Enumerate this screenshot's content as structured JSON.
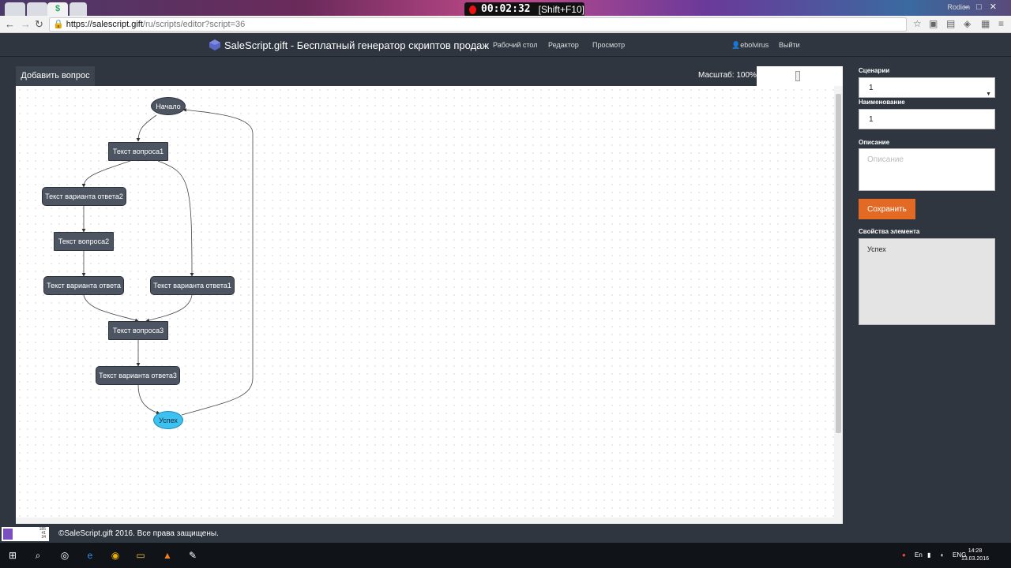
{
  "browser": {
    "url_host": "https://salescript.gift",
    "url_path": "/ru/scripts/editor?script=36",
    "tab_icon": "$"
  },
  "recording": {
    "time": "00:02:32",
    "hotkey": "[Shift+F10]"
  },
  "window": {
    "user": "Rodion"
  },
  "app": {
    "brand": "SaleScript.gift - Бесплатный генератор скриптов продаж",
    "nav": [
      "Рабочий стол",
      "Редактор",
      "Просмотр"
    ],
    "username": "ebolvirus",
    "logout": "Выйти"
  },
  "editor": {
    "add_question": "Добавить вопрос",
    "zoom_label": "Масштаб: 100%",
    "nodes": {
      "start": "Начало",
      "q1": "Текст вопроса1",
      "a2": "Текст варианта ответа2",
      "q2": "Текст вопроса2",
      "a0": "Текст варианта ответа",
      "a1": "Текст варианта ответа1",
      "q3": "Текст вопроса3",
      "a3": "Текст варианта ответа3",
      "success": "Успех"
    }
  },
  "panel": {
    "scenarios_label": "Сценарии",
    "scenario_value": "1",
    "name_label": "Наименование",
    "name_value": "1",
    "description_label": "Описание",
    "description_placeholder": "Описание",
    "save": "Сохранить",
    "props_label": "Свойства элемента",
    "props_value": "Успех"
  },
  "footer": {
    "copyright": "©SaleScript.gift 2016. Все права защищены.",
    "widget_lines": [
      "185",
      "41",
      "34"
    ]
  },
  "taskbar": {
    "lang": "ENG",
    "time": "14:28",
    "date": "13.03.2016"
  },
  "colors": {
    "header_bg": "#2f3640",
    "node_bg": "#4c5561",
    "success_node": "#3cc1f0",
    "save_button": "#e36a25"
  }
}
